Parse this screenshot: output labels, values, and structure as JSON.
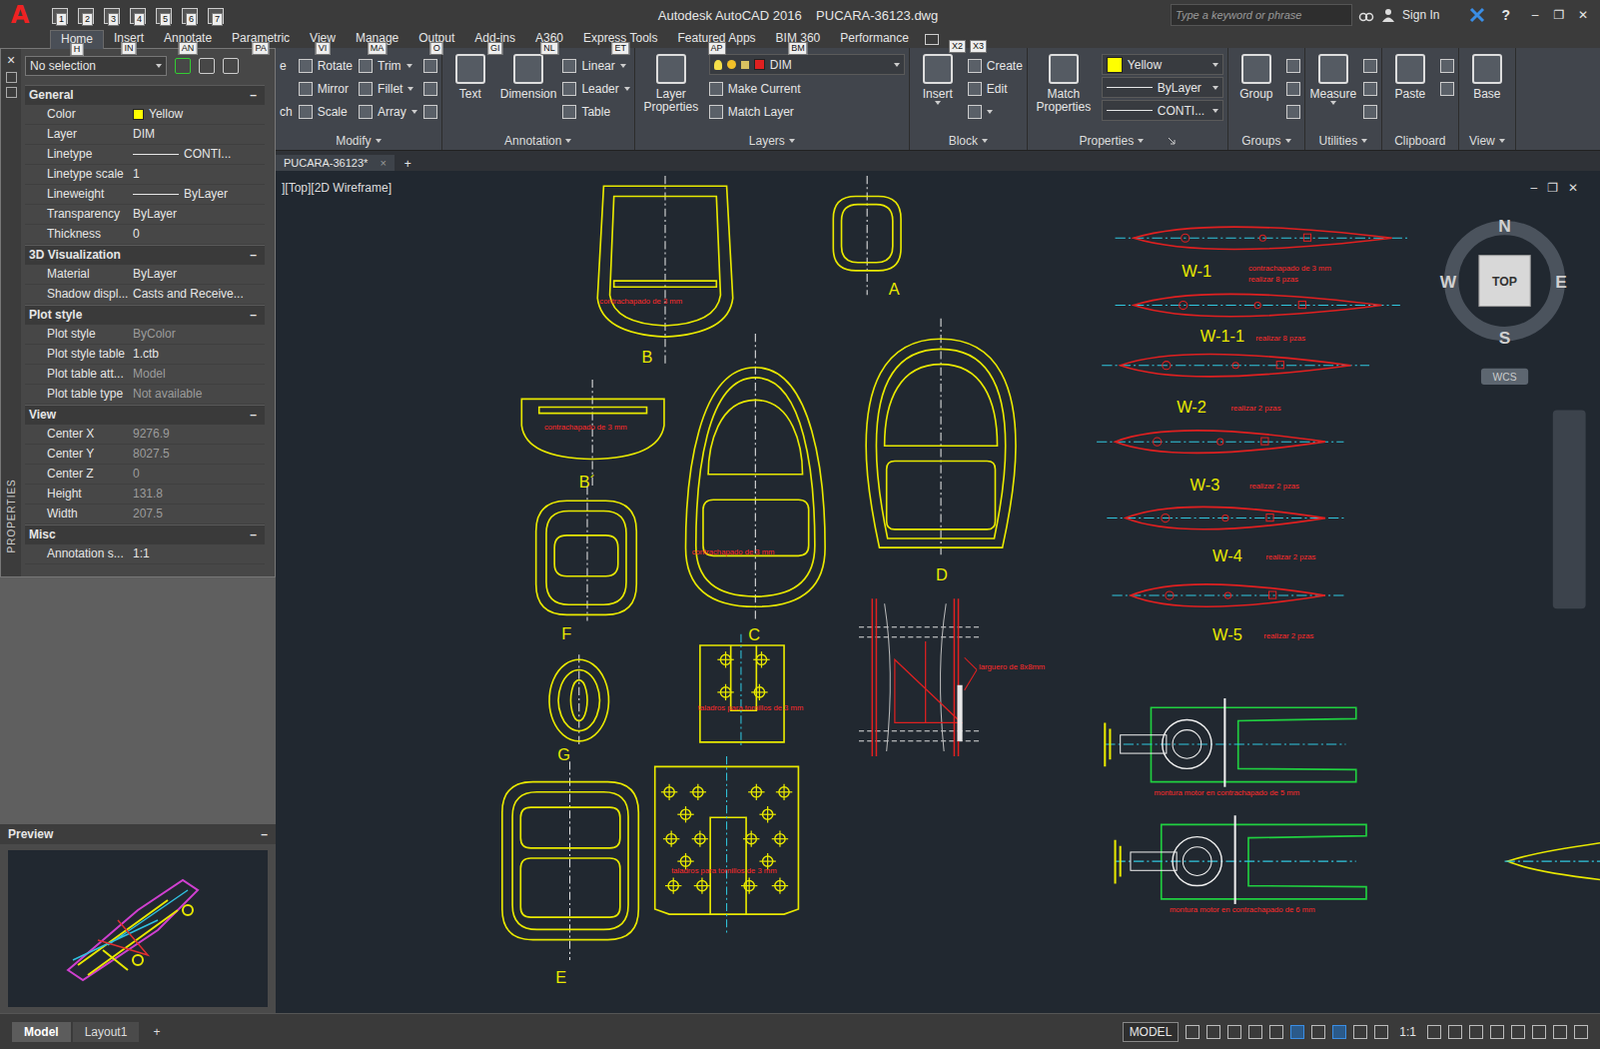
{
  "window": {
    "app_logo": "A",
    "title": "Autodesk AutoCAD 2016    PUCARA-36123.dwg",
    "controls": [
      "–",
      "❐",
      "✕"
    ]
  },
  "quick_access": [
    {
      "keytip": "1"
    },
    {
      "keytip": "2"
    },
    {
      "keytip": "3"
    },
    {
      "keytip": "4"
    },
    {
      "keytip": "5"
    },
    {
      "keytip": "6"
    },
    {
      "keytip": "7"
    }
  ],
  "search": {
    "placeholder": "Type a keyword or phrase"
  },
  "account": {
    "label": "Sign In"
  },
  "help": "?",
  "ribbon_tabs": [
    {
      "label": "Home",
      "keytip": "H",
      "selected": true
    },
    {
      "label": "Insert",
      "keytip": "IN",
      "selected": false
    },
    {
      "label": "Annotate",
      "keytip": "AN",
      "selected": false
    },
    {
      "label": "Parametric",
      "keytip": "PA",
      "selected": false
    },
    {
      "label": "View",
      "keytip": "VI",
      "selected": false
    },
    {
      "label": "Manage",
      "keytip": "MA",
      "selected": false
    },
    {
      "label": "Output",
      "keytip": "O",
      "selected": false
    },
    {
      "label": "Add-ins",
      "keytip": "GI",
      "selected": false
    },
    {
      "label": "A360",
      "keytip": "NL",
      "selected": false
    },
    {
      "label": "Express Tools",
      "keytip": "ET",
      "selected": false
    },
    {
      "label": "Featured Apps",
      "keytip": "AP",
      "selected": false
    },
    {
      "label": "BIM 360",
      "keytip": "BM",
      "selected": false
    },
    {
      "label": "Performance",
      "keytip": null,
      "selected": false
    }
  ],
  "ribbon_extra_keytips": [
    "X2",
    "X3"
  ],
  "ribbon_panels": [
    {
      "title": "Modify",
      "dropdown": true,
      "launcher": false,
      "columns": [
        [
          {
            "kind": "cut",
            "label": "e"
          },
          {
            "kind": "spacer"
          },
          {
            "kind": "cut",
            "label": "ch"
          }
        ],
        [
          {
            "kind": "small",
            "label": "Rotate"
          },
          {
            "kind": "small",
            "label": "Mirror"
          },
          {
            "kind": "small",
            "label": "Scale"
          }
        ],
        [
          {
            "kind": "small",
            "label": "Trim",
            "dropdown": true
          },
          {
            "kind": "small",
            "label": "Fillet",
            "dropdown": true
          },
          {
            "kind": "small",
            "label": "Array",
            "dropdown": true
          }
        ],
        [
          {
            "kind": "icon"
          },
          {
            "kind": "icon"
          },
          {
            "kind": "icon"
          }
        ]
      ]
    },
    {
      "title": "Annotation",
      "dropdown": true,
      "launcher": false,
      "columns": [
        [
          {
            "kind": "large",
            "label": "Text"
          }
        ],
        [
          {
            "kind": "large",
            "label": "Dimension"
          }
        ],
        [
          {
            "kind": "small",
            "label": "Linear",
            "dropdown": true
          },
          {
            "kind": "small",
            "label": "Leader",
            "dropdown": true
          },
          {
            "kind": "small",
            "label": "Table"
          }
        ]
      ]
    },
    {
      "title": "Layers",
      "dropdown": true,
      "launcher": false,
      "columns": [
        [
          {
            "kind": "large",
            "label": "Layer Properties"
          }
        ],
        [
          {
            "kind": "layer",
            "label": "DIM",
            "color": "#e02020"
          },
          {
            "kind": "small",
            "label": "Make Current"
          },
          {
            "kind": "small",
            "label": "Match Layer"
          }
        ]
      ]
    },
    {
      "title": "Block",
      "dropdown": true,
      "launcher": false,
      "columns": [
        [
          {
            "kind": "large",
            "label": "Insert",
            "dropdown": true
          }
        ],
        [
          {
            "kind": "small",
            "label": "Create"
          },
          {
            "kind": "small",
            "label": "Edit"
          },
          {
            "kind": "icon",
            "dropdown": true
          }
        ]
      ]
    },
    {
      "title": "Properties",
      "dropdown": true,
      "launcher": true,
      "columns": [
        [
          {
            "kind": "large",
            "label": "Match Properties"
          }
        ],
        [
          {
            "kind": "combo",
            "label": "Yellow",
            "color": "#ffff00"
          },
          {
            "kind": "combo",
            "label": "ByLayer",
            "line": true
          },
          {
            "kind": "combo",
            "label": "CONTI...",
            "line": true
          }
        ]
      ]
    },
    {
      "title": "Groups",
      "dropdown": true,
      "launcher": false,
      "columns": [
        [
          {
            "kind": "large",
            "label": "Group"
          }
        ],
        [
          {
            "kind": "icon"
          },
          {
            "kind": "icon"
          },
          {
            "kind": "icon"
          }
        ]
      ]
    },
    {
      "title": "Utilities",
      "dropdown": true,
      "launcher": false,
      "columns": [
        [
          {
            "kind": "large",
            "label": "Measure",
            "dropdown": true
          }
        ],
        [
          {
            "kind": "icon"
          },
          {
            "kind": "icon"
          },
          {
            "kind": "icon"
          }
        ]
      ]
    },
    {
      "title": "Clipboard",
      "dropdown": false,
      "launcher": false,
      "columns": [
        [
          {
            "kind": "large",
            "label": "Paste"
          }
        ],
        [
          {
            "kind": "icon"
          },
          {
            "kind": "icon"
          }
        ]
      ]
    },
    {
      "title": "View",
      "dropdown": true,
      "launcher": false,
      "columns": [
        [
          {
            "kind": "large",
            "label": "Base"
          }
        ]
      ]
    }
  ],
  "properties_palette": {
    "title": "PROPERTIES",
    "close": "×",
    "selection": "No selection",
    "sections": [
      {
        "title": "General",
        "expanded": true,
        "toggle": "–",
        "rows": [
          {
            "label": "Color",
            "value": "Yellow",
            "kind": "color",
            "color": "#ffff00",
            "greyed": false
          },
          {
            "label": "Layer",
            "value": "DIM",
            "kind": "text",
            "greyed": false
          },
          {
            "label": "Linetype",
            "value": "CONTI...",
            "kind": "line",
            "greyed": false
          },
          {
            "label": "Linetype scale",
            "value": "1",
            "kind": "text",
            "greyed": false
          },
          {
            "label": "Lineweight",
            "value": "ByLayer",
            "kind": "line",
            "greyed": false
          },
          {
            "label": "Transparency",
            "value": "ByLayer",
            "kind": "text",
            "greyed": false
          },
          {
            "label": "Thickness",
            "value": "0",
            "kind": "text",
            "greyed": false
          }
        ]
      },
      {
        "title": "3D Visualization",
        "expanded": true,
        "toggle": "–",
        "rows": [
          {
            "label": "Material",
            "value": "ByLayer",
            "kind": "text",
            "greyed": false
          },
          {
            "label": "Shadow displ...",
            "value": "Casts and Receive...",
            "kind": "text",
            "greyed": false
          }
        ]
      },
      {
        "title": "Plot style",
        "expanded": true,
        "toggle": "–",
        "rows": [
          {
            "label": "Plot style",
            "value": "ByColor",
            "kind": "text",
            "greyed": true
          },
          {
            "label": "Plot style table",
            "value": "1.ctb",
            "kind": "text",
            "greyed": false
          },
          {
            "label": "Plot table att...",
            "value": "Model",
            "kind": "text",
            "greyed": true
          },
          {
            "label": "Plot table type",
            "value": "Not available",
            "kind": "text",
            "greyed": true
          }
        ]
      },
      {
        "title": "View",
        "expanded": true,
        "toggle": "–",
        "rows": [
          {
            "label": "Center X",
            "value": "9276.9",
            "kind": "text",
            "greyed": true
          },
          {
            "label": "Center Y",
            "value": "8027.5",
            "kind": "text",
            "greyed": true
          },
          {
            "label": "Center Z",
            "value": "0",
            "kind": "text",
            "greyed": true
          },
          {
            "label": "Height",
            "value": "131.8",
            "kind": "text",
            "greyed": true
          },
          {
            "label": "Width",
            "value": "207.5",
            "kind": "text",
            "greyed": true
          }
        ]
      },
      {
        "title": "Misc",
        "expanded": true,
        "toggle": "–",
        "rows": [
          {
            "label": "Annotation s...",
            "value": "1:1",
            "kind": "text",
            "greyed": false
          }
        ]
      }
    ]
  },
  "preview": {
    "title": "Preview",
    "toggle": "–"
  },
  "document_tabs": [
    {
      "label": "PUCARA-36123*",
      "selected": true,
      "close": "×"
    }
  ],
  "new_tab": "+",
  "viewport": {
    "label": "][Top][2D Wireframe]",
    "controls": [
      "–",
      "❐",
      "✕"
    ]
  },
  "viewcube": {
    "north": "N",
    "south": "S",
    "east": "E",
    "west": "W",
    "face": "TOP",
    "ucs": "WCS"
  },
  "parts": [
    {
      "label": "B",
      "kind": "hood",
      "note": "contrachapado de 3 mm"
    },
    {
      "label": "A",
      "kind": "oval",
      "note": null
    },
    {
      "label": "B´",
      "kind": "tab",
      "note": "contrachapado de 3 mm"
    },
    {
      "label": "C",
      "kind": "egg",
      "note": "contrachapado de 3 mm"
    },
    {
      "label": "D",
      "kind": "shield",
      "note": null
    },
    {
      "label": "F",
      "kind": "cushion",
      "note": null
    },
    {
      "label": "G",
      "kind": "ring",
      "note": null
    },
    {
      "label": "E",
      "kind": "frame",
      "note": null
    }
  ],
  "plates": [
    {
      "kind": "small-plate",
      "note": "taladros para tornillos de 3 mm"
    },
    {
      "kind": "large-plate",
      "note": "taladros para tornillos de 3 mm"
    }
  ],
  "spar": {
    "note": "larguero de 8x8mm"
  },
  "airfoils": [
    {
      "label": "W-1",
      "notes": [
        "contrachapado de 3 mm",
        "realizar 8 pzas"
      ]
    },
    {
      "label": "W-1-1",
      "notes": [
        "realizar 8 pzas"
      ]
    },
    {
      "label": "W-2",
      "notes": [
        "realizar 2 pzas"
      ]
    },
    {
      "label": "W-3",
      "notes": [
        "realizar 2 pzas"
      ]
    },
    {
      "label": "W-4",
      "notes": [
        "realizar 2 pzas"
      ]
    },
    {
      "label": "W-5",
      "notes": [
        "realizar 2 pzas"
      ]
    }
  ],
  "engine_mounts": [
    {
      "note": "montura motor en contrachapado de 5 mm"
    },
    {
      "note": "montura motor en contrachapado de 6 mm"
    }
  ],
  "layout_tabs": [
    {
      "label": "Model",
      "selected": true
    },
    {
      "label": "Layout1",
      "selected": false
    }
  ],
  "new_layout": "+",
  "status_bar": {
    "space": "MODEL",
    "scale": "1:1"
  }
}
